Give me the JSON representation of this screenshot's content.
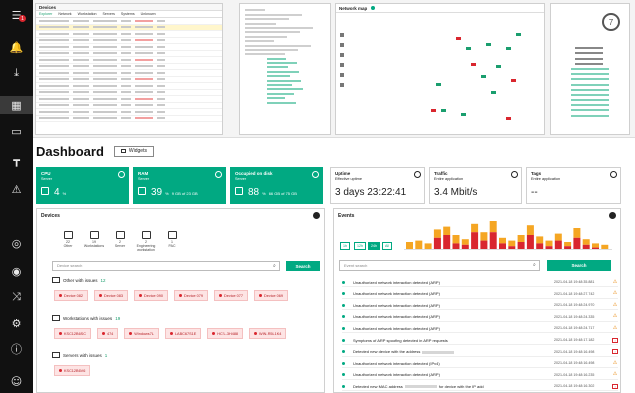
{
  "sidebar": {
    "items": [
      {
        "icon": "menu-icon",
        "glyph": "☰"
      },
      {
        "icon": "bell-icon",
        "glyph": "🔔",
        "badge": "1"
      },
      {
        "icon": "download-icon",
        "glyph": "⤓"
      },
      {
        "icon": "dashboard-icon",
        "glyph": "▦"
      },
      {
        "icon": "devices-icon",
        "glyph": "▭"
      },
      {
        "icon": "topology-icon",
        "glyph": "┳"
      },
      {
        "icon": "alert-icon",
        "glyph": "⚠"
      },
      {
        "icon": "globe-icon",
        "glyph": "◎"
      },
      {
        "icon": "network-icon",
        "glyph": "◉"
      },
      {
        "icon": "flow-icon",
        "glyph": "⤨"
      },
      {
        "icon": "settings-icon",
        "glyph": "⚙"
      },
      {
        "icon": "info-icon",
        "glyph": "ⓘ"
      },
      {
        "icon": "user-icon",
        "glyph": "☺"
      }
    ]
  },
  "preview": {
    "left_title": "Devices",
    "left_tabs": [
      "Explorer",
      "Network",
      "Workstation",
      "Servers",
      "Systems",
      "Unknown"
    ],
    "middle_title": "Network map",
    "right_badge": "7"
  },
  "dashboard": {
    "title": "Dashboard",
    "widgets_label": "Widgets"
  },
  "cards": [
    {
      "title": "CPU",
      "sub": "Server",
      "value": "4",
      "unit": "%",
      "teal": true
    },
    {
      "title": "RAM",
      "sub": "Server",
      "value": "39",
      "unit": "%",
      "note": "9 GB of 23 GB",
      "teal": true
    },
    {
      "title": "Occupied on disk",
      "sub": "Server",
      "value": "88",
      "unit": "%",
      "note": "66 GB of 75 GB",
      "teal": true
    },
    {
      "title": "Uptime",
      "sub": "Effective uptime",
      "value": "3 days 23:22:41",
      "teal": false
    },
    {
      "title": "Traffic",
      "sub": "Entire application",
      "value": "3.4 Mbit/s",
      "teal": false
    },
    {
      "title": "Tags",
      "sub": "Entire application",
      "value": "--",
      "teal": false
    }
  ],
  "devices": {
    "title": "Devices",
    "types": [
      {
        "count": "22",
        "label": "Other"
      },
      {
        "count": "19",
        "label": "Workstations"
      },
      {
        "count": "2",
        "label": "Server"
      },
      {
        "count": "2",
        "label": "Engineering workstation"
      },
      {
        "count": "1",
        "label": "PAC"
      }
    ],
    "search_placeholder": "Device search",
    "search_button": "Search",
    "groups": [
      {
        "label": "Other with issues",
        "count": "12",
        "chips": [
          "Device 082",
          "Device 083",
          "Device 090",
          "Device 079",
          "Device 077",
          "Device 069"
        ]
      },
      {
        "label": "Workstations with issues",
        "count": "19",
        "chips": [
          "KSC12B6SC",
          "474",
          "Windows7L",
          "LABC67S1E",
          "HC'L-3H488",
          "WIN-R5L1K4"
        ]
      },
      {
        "label": "Servers with issues",
        "count": "1",
        "chips": [
          "KSC12B6V6"
        ]
      }
    ]
  },
  "events": {
    "title": "Events",
    "ranges": [
      "1h",
      "12h",
      "24h",
      "All"
    ],
    "active_range": "24h",
    "search_placeholder": "Event search",
    "search_button": "Search",
    "rows": [
      {
        "msg": "Unauthorized network interaction detected (ARP)",
        "ts": "2021-04-18 19:48:35.881",
        "level": "warn"
      },
      {
        "msg": "Unauthorized network interaction detected (ARP)",
        "ts": "2021-04-18 19:48:27.742",
        "level": "warn"
      },
      {
        "msg": "Unauthorized network interaction detected (ARP)",
        "ts": "2021-04-18 19:48:24.970",
        "level": "warn"
      },
      {
        "msg": "Unauthorized network interaction detected (ARP)",
        "ts": "2021-04-18 19:48:24.335",
        "level": "warn"
      },
      {
        "msg": "Unauthorized network interaction detected (ARP)",
        "ts": "2021-04-18 19:48:24.717",
        "level": "warn"
      },
      {
        "msg": "Symptoms of ARP spoofing detected in ARP requests",
        "ts": "2021-04-18 19:48:17.182",
        "level": "err"
      },
      {
        "msg": "Detected new device with the address",
        "ts": "2021-04-18 19:48:16.498",
        "level": "err",
        "blur": true
      },
      {
        "msg": "Unauthorized network interaction detected (IPv4)",
        "ts": "2021-04-18 19:48:16.498",
        "level": "warn"
      },
      {
        "msg": "Unauthorized network interaction detected (ARP)",
        "ts": "2021-04-18 19:48:16.235",
        "level": "warn"
      },
      {
        "msg": "Detected new MAC address",
        "tail": "for device with the IP add",
        "ts": "2021-04-18 19:48:16.302",
        "level": "err",
        "blur": true
      }
    ],
    "chart": {
      "bars": [
        {
          "h": 0.25,
          "red": 0.0
        },
        {
          "h": 0.3,
          "red": 0.0
        },
        {
          "h": 0.2,
          "red": 0.0
        },
        {
          "h": 0.7,
          "red": 0.4
        },
        {
          "h": 0.8,
          "red": 0.5
        },
        {
          "h": 0.5,
          "red": 0.2
        },
        {
          "h": 0.35,
          "red": 0.15
        },
        {
          "h": 0.9,
          "red": 0.6
        },
        {
          "h": 0.6,
          "red": 0.3
        },
        {
          "h": 1.0,
          "red": 0.6
        },
        {
          "h": 0.4,
          "red": 0.2
        },
        {
          "h": 0.3,
          "red": 0.1
        },
        {
          "h": 0.5,
          "red": 0.25
        },
        {
          "h": 0.85,
          "red": 0.5
        },
        {
          "h": 0.45,
          "red": 0.2
        },
        {
          "h": 0.3,
          "red": 0.1
        },
        {
          "h": 0.55,
          "red": 0.3
        },
        {
          "h": 0.25,
          "red": 0.1
        },
        {
          "h": 0.75,
          "red": 0.4
        },
        {
          "h": 0.35,
          "red": 0.15
        },
        {
          "h": 0.2,
          "red": 0.05
        },
        {
          "h": 0.15,
          "red": 0.0
        }
      ]
    }
  },
  "colors": {
    "accent": "#01a982",
    "sidebar": "#111111",
    "danger": "#d9262e",
    "warning": "#e88a10"
  }
}
